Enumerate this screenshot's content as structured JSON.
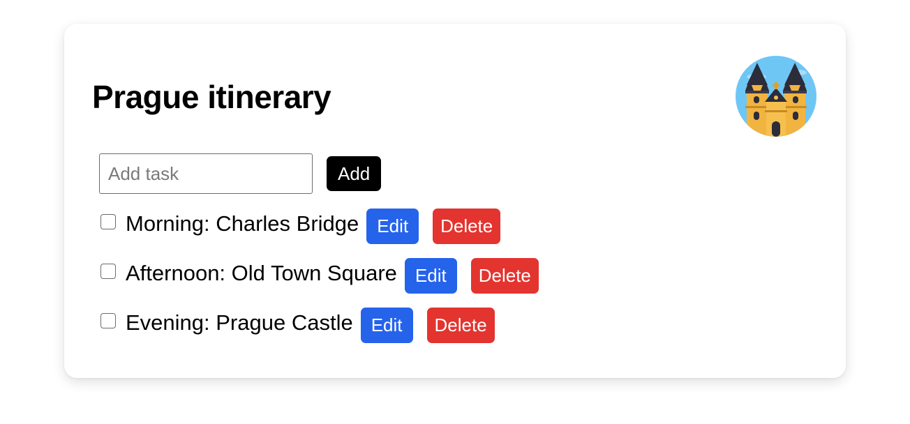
{
  "card": {
    "title": "Prague itinerary",
    "avatar_icon": "prague-church-icon"
  },
  "add_form": {
    "placeholder": "Add task",
    "value": "",
    "add_label": "Add"
  },
  "tasks": [
    {
      "text": "Morning: Charles Bridge",
      "checked": false,
      "edit_label": "Edit",
      "delete_label": "Delete"
    },
    {
      "text": "Afternoon: Old Town Square",
      "checked": false,
      "edit_label": "Edit",
      "delete_label": "Delete"
    },
    {
      "text": "Evening: Prague Castle",
      "checked": false,
      "edit_label": "Edit",
      "delete_label": "Delete"
    }
  ],
  "colors": {
    "edit": "#2563eb",
    "delete": "#e3342f",
    "add": "#000000"
  }
}
